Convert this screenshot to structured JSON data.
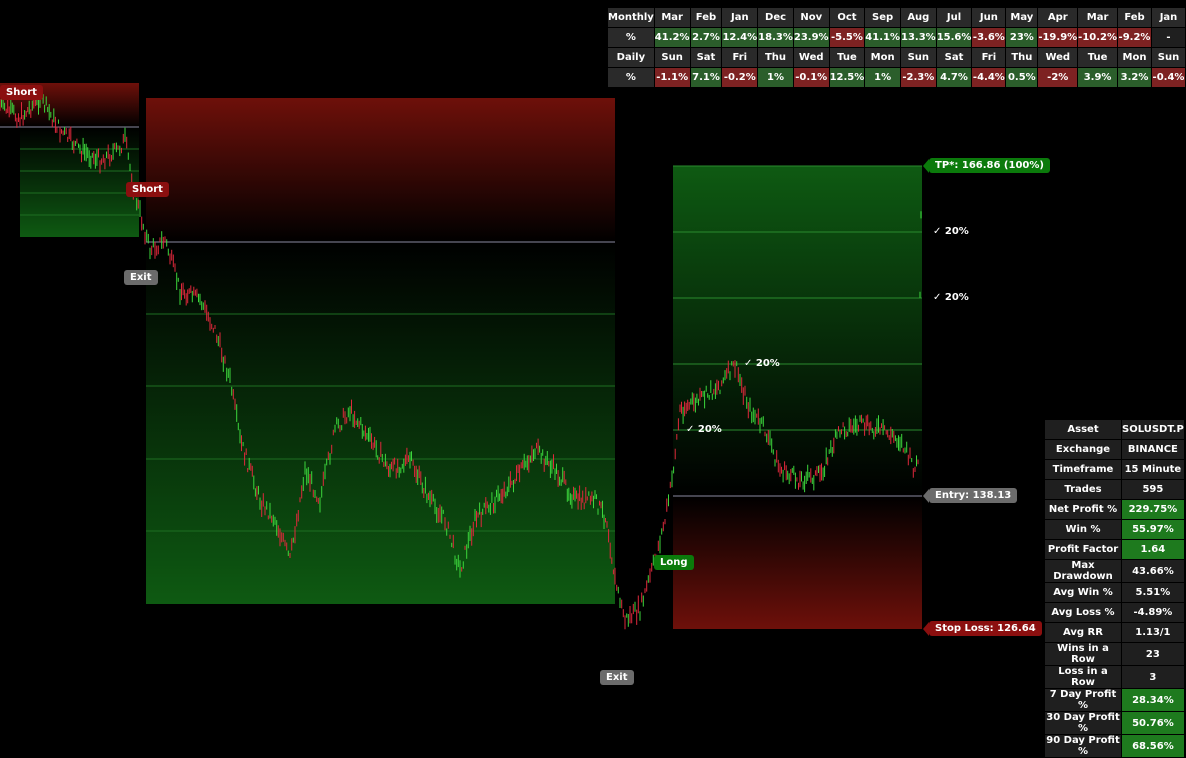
{
  "performance_table": {
    "monthly_header": "Monthly",
    "months": [
      "Mar",
      "Feb",
      "Jan",
      "Dec",
      "Nov",
      "Oct",
      "Sep",
      "Aug",
      "Jul",
      "Jun",
      "May",
      "Apr",
      "Mar",
      "Feb",
      "Jan"
    ],
    "monthly_label": "%",
    "monthly_values": [
      "41.2%",
      "2.7%",
      "12.4%",
      "18.3%",
      "23.9%",
      "-5.5%",
      "41.1%",
      "13.3%",
      "15.6%",
      "-3.6%",
      "23%",
      "-19.9%",
      "-10.2%",
      "-9.2%",
      "-"
    ],
    "daily_header": "Daily",
    "days": [
      "Sun",
      "Sat",
      "Fri",
      "Thu",
      "Wed",
      "Tue",
      "Mon",
      "Sun",
      "Sat",
      "Fri",
      "Thu",
      "Wed",
      "Tue",
      "Mon",
      "Sun"
    ],
    "daily_label": "%",
    "daily_values": [
      "-1.1%",
      "7.1%",
      "-0.2%",
      "1%",
      "-0.1%",
      "12.5%",
      "1%",
      "-2.3%",
      "4.7%",
      "-4.4%",
      "0.5%",
      "-2%",
      "3.9%",
      "3.2%",
      "-0.4%"
    ]
  },
  "stats_table": {
    "rows": [
      {
        "k": "Asset",
        "v": "SOLUSDT.P",
        "style": ""
      },
      {
        "k": "Exchange",
        "v": "BINANCE",
        "style": ""
      },
      {
        "k": "Timeframe",
        "v": "15 Minute",
        "style": ""
      },
      {
        "k": "Trades",
        "v": "595",
        "style": ""
      },
      {
        "k": "Net Profit %",
        "v": "229.75%",
        "style": "pos"
      },
      {
        "k": "Win %",
        "v": "55.97%",
        "style": "pos"
      },
      {
        "k": "Profit Factor",
        "v": "1.64",
        "style": "pos"
      },
      {
        "k": "Max Drawdown",
        "v": "43.66%",
        "style": ""
      },
      {
        "k": "Avg Win %",
        "v": "5.51%",
        "style": ""
      },
      {
        "k": "Avg Loss %",
        "v": "-4.89%",
        "style": ""
      },
      {
        "k": "Avg RR",
        "v": "1.13/1",
        "style": ""
      },
      {
        "k": "Wins in a Row",
        "v": "23",
        "style": ""
      },
      {
        "k": "Loss in a Row",
        "v": "3",
        "style": ""
      },
      {
        "k": "7 Day Profit %",
        "v": "28.34%",
        "style": "pos"
      },
      {
        "k": "30 Day Profit %",
        "v": "50.76%",
        "style": "pos"
      },
      {
        "k": "90 Day Profit %",
        "v": "68.56%",
        "style": "pos"
      }
    ]
  },
  "labels": {
    "short1": "Short",
    "short2": "Short",
    "exit1": "Exit",
    "exit2": "Exit",
    "long": "Long",
    "tp": "TP*: 166.86 (100%)",
    "entry": "Entry: 138.13",
    "stop_loss": "Stop Loss: 126.64",
    "check_marks": [
      "✓ 20%",
      "✓ 20%",
      "✓ 20%",
      "✓ 20%"
    ]
  },
  "colors": {
    "up": "#3cd63c",
    "down": "#e0283c",
    "profit_zone": "#0e5a12",
    "loss_zone": "#6e100a",
    "accent_green": "#0b7a0b",
    "accent_red": "#8b0f0f"
  }
}
